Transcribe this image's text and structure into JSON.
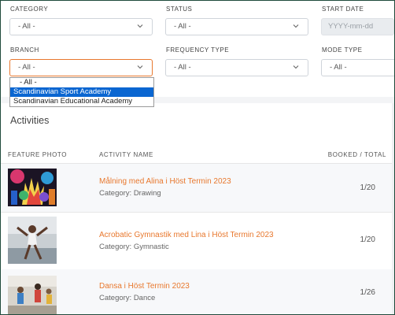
{
  "filters": {
    "category_label": "CATEGORY",
    "category_value": "- All -",
    "status_label": "STATUS",
    "status_value": "- All -",
    "start_date_label": "START DATE",
    "start_date_placeholder": "YYYY-mm-dd",
    "branch_label": "BRANCH",
    "branch_value": "- All -",
    "frequency_label": "FREQUENCY TYPE",
    "frequency_value": "- All -",
    "mode_label": "MODE TYPE",
    "mode_value": "- All -"
  },
  "branch_dropdown": {
    "options": [
      "- All -",
      "Scandinavian Sport Academy",
      "Scandinavian Educational Academy"
    ],
    "highlighted_index": 1
  },
  "activities": {
    "title": "Activities",
    "columns": {
      "photo": "FEATURE PHOTO",
      "name": "ACTIVITY NAME",
      "booked": "BOOKED / TOTAL"
    },
    "rows": [
      {
        "name": "Målning med Alina i Höst Termin 2023",
        "category": "Category: Drawing",
        "booked": "1/20"
      },
      {
        "name": "Acrobatic Gymnastik med Lina i Höst Termin 2023",
        "category": "Category: Gymnastic",
        "booked": "1/20"
      },
      {
        "name": "Dansa i Höst Termin 2023",
        "category": "Category: Dance",
        "booked": "1/26"
      }
    ]
  },
  "colors": {
    "accent": "#e8782e",
    "selected_option": "#0a66d1",
    "frame_border": "#1f4a3b"
  }
}
